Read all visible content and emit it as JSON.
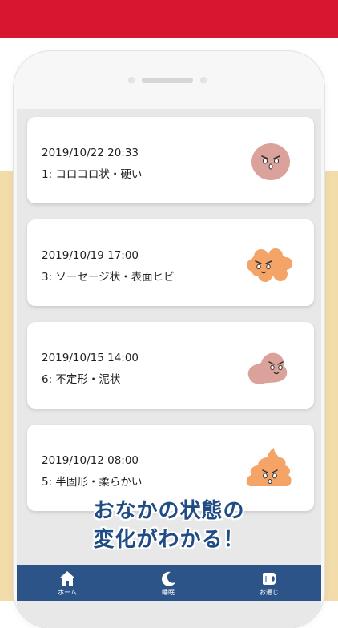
{
  "entries": [
    {
      "datetime": "2019/10/22 20:33",
      "description": "1: コロコロ状・硬い",
      "icon": "hard-lumps-stool-icon"
    },
    {
      "datetime": "2019/10/19 17:00",
      "description": "3: ソーセージ状・表面ヒビ",
      "icon": "cracked-sausage-stool-icon"
    },
    {
      "datetime": "2019/10/15 14:00",
      "description": "6: 不定形・泥状",
      "icon": "mushy-stool-icon"
    },
    {
      "datetime": "2019/10/12 08:00",
      "description": "5: 半固形・柔らかい",
      "icon": "soft-blob-stool-icon"
    }
  ],
  "headline": {
    "line1": "おなかの状態の",
    "line2": "変化がわかる！"
  },
  "tabs": [
    {
      "label": "ホーム",
      "icon": "home-icon"
    },
    {
      "label": "睡眠",
      "icon": "moon-icon"
    },
    {
      "label": "お通じ",
      "icon": "toilet-paper-icon"
    }
  ],
  "colors": {
    "brand_red": "#d7162f",
    "beige": "#f2dcaa",
    "navy": "#2d5488",
    "headline": "#1f4c84",
    "pink": "#dba29b",
    "orange": "#f5a468"
  }
}
